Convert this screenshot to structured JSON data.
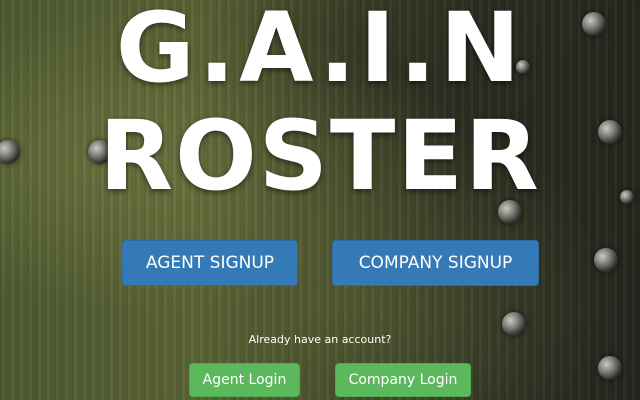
{
  "hero": {
    "title_line1": "G.A.I.N",
    "title_line2": "ROSTER"
  },
  "signup": {
    "agent_label": "AGENT SIGNUP",
    "company_label": "COMPANY SIGNUP"
  },
  "login": {
    "prompt": "Already have an account?",
    "agent_label": "Agent Login",
    "company_label": "Company Login"
  },
  "colors": {
    "primary_button": "#337ab7",
    "success_button": "#5cb85c",
    "text": "#ffffff"
  }
}
